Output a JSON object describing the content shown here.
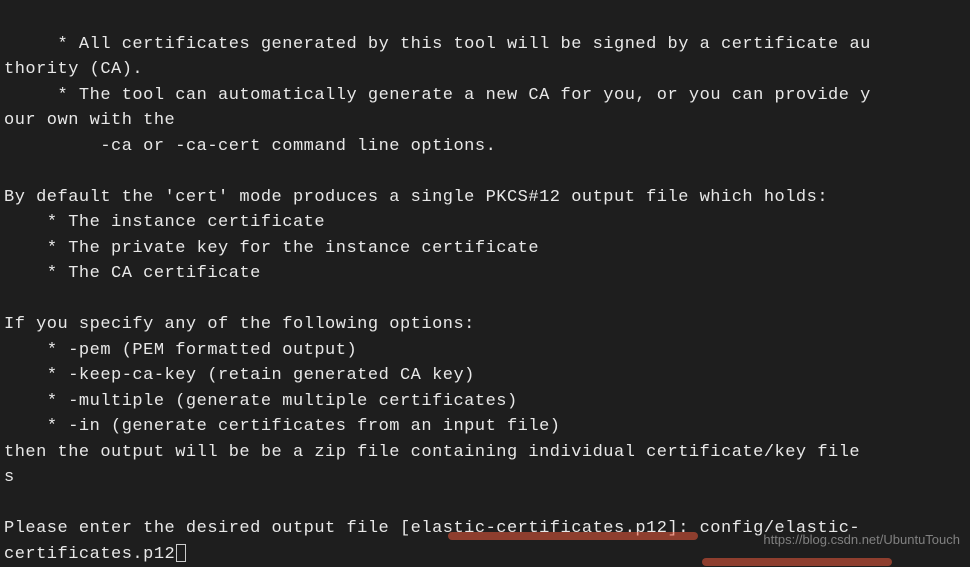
{
  "terminal": {
    "line1": "     * All certificates generated by this tool will be signed by a certificate au",
    "line2": "thority (CA).",
    "line3": "     * The tool can automatically generate a new CA for you, or you can provide y",
    "line4": "our own with the",
    "line5": "         -ca or -ca-cert command line options.",
    "line6": "",
    "line7": "By default the 'cert' mode produces a single PKCS#12 output file which holds:",
    "line8": "    * The instance certificate",
    "line9": "    * The private key for the instance certificate",
    "line10": "    * The CA certificate",
    "line11": "",
    "line12": "If you specify any of the following options:",
    "line13": "    * -pem (PEM formatted output)",
    "line14": "    * -keep-ca-key (retain generated CA key)",
    "line15": "    * -multiple (generate multiple certificates)",
    "line16": "    * -in (generate certificates from an input file)",
    "line17": "then the output will be be a zip file containing individual certificate/key file",
    "line18": "s",
    "line19": "",
    "prompt": "Please enter the desired output file [elastic-certificates.p12]: ",
    "input_part1": "config/elastic-",
    "input_part2": "certificates.p12"
  },
  "watermark": "https://blog.csdn.net/UbuntuTouch"
}
